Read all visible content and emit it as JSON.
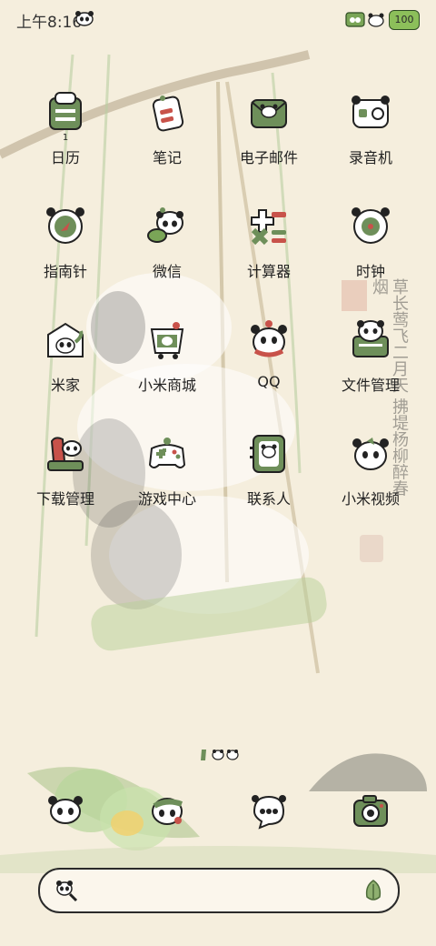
{
  "status": {
    "time": "上午8:16",
    "battery": "100"
  },
  "apps": [
    {
      "label": "日历",
      "sub": "1",
      "icon": "calendar-icon"
    },
    {
      "label": "笔记",
      "icon": "notes-icon"
    },
    {
      "label": "电子邮件",
      "icon": "email-icon"
    },
    {
      "label": "录音机",
      "icon": "recorder-icon"
    },
    {
      "label": "指南针",
      "icon": "compass-icon"
    },
    {
      "label": "微信",
      "icon": "wechat-icon"
    },
    {
      "label": "计算器",
      "icon": "calculator-icon"
    },
    {
      "label": "时钟",
      "icon": "clock-icon"
    },
    {
      "label": "米家",
      "icon": "mijia-icon"
    },
    {
      "label": "小米商城",
      "icon": "mi-store-icon"
    },
    {
      "label": "QQ",
      "icon": "qq-icon"
    },
    {
      "label": "文件管理",
      "icon": "file-manager-icon"
    },
    {
      "label": "下载管理",
      "icon": "download-icon"
    },
    {
      "label": "游戏中心",
      "icon": "game-center-icon"
    },
    {
      "label": "联系人",
      "icon": "contacts-icon"
    },
    {
      "label": "小米视频",
      "icon": "mi-video-icon"
    }
  ],
  "dock": [
    "phone-icon",
    "browser-icon",
    "messages-icon",
    "camera-icon"
  ],
  "wallpaper_poem": "草长莺飞二月天 拂堤杨柳醉春烟",
  "colors": {
    "accent_green": "#6e8f5a",
    "accent_red": "#c8524a",
    "background": "#f5eedd"
  }
}
